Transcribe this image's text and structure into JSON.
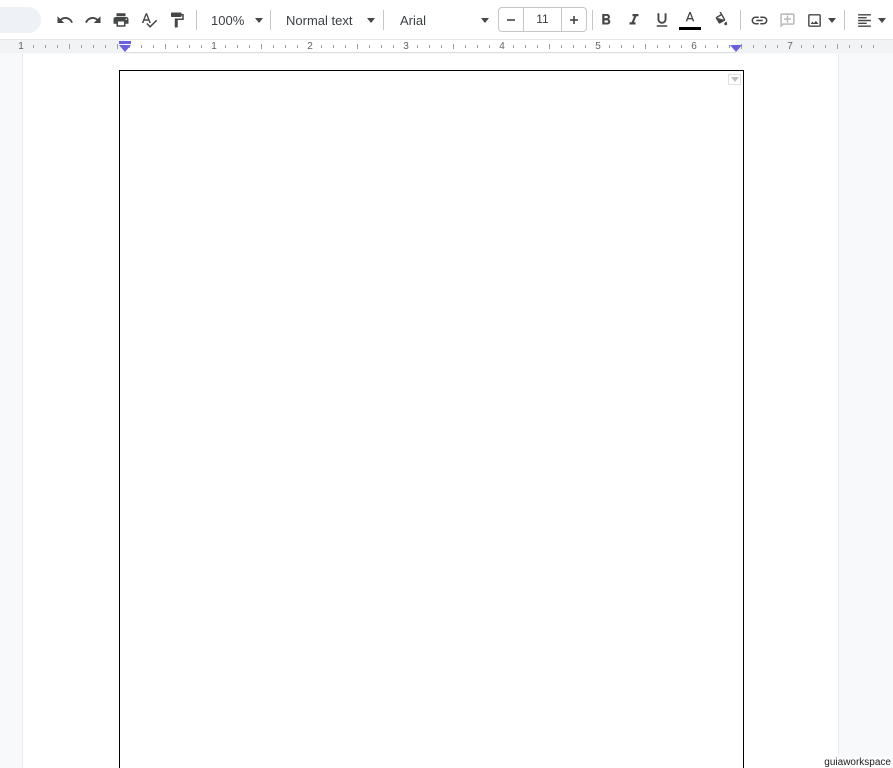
{
  "toolbar": {
    "zoom": "100%",
    "style": "Normal text",
    "font": "Arial",
    "font_size": "11",
    "text_color": "#000000",
    "accent": "#6a5fe0"
  },
  "ruler": {
    "numbers": [
      "1",
      "1",
      "2",
      "3",
      "4",
      "5",
      "6",
      "7"
    ]
  },
  "watermark": "guiaworkspace"
}
